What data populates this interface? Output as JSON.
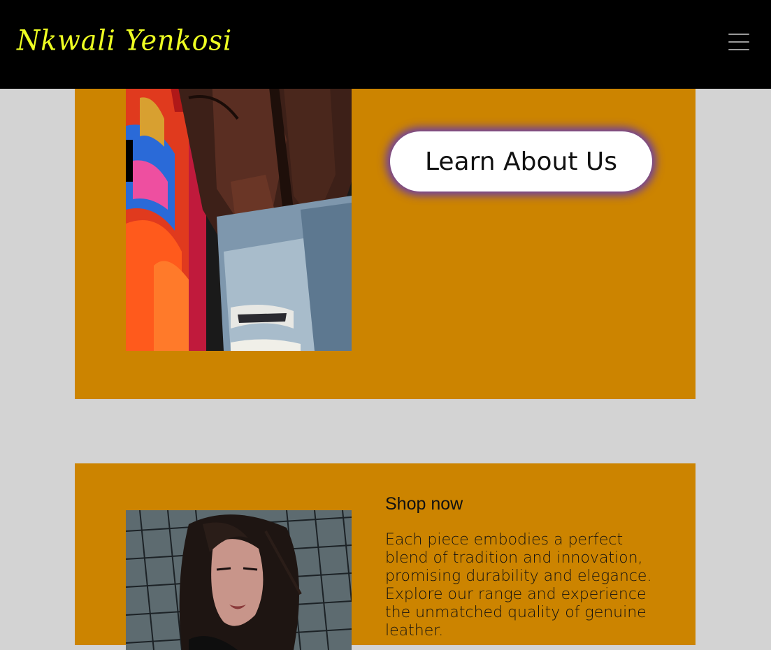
{
  "header": {
    "brand": "Nkwali Yenkosi",
    "brand_color": "#eeff22",
    "menu_icon": "hamburger-icon"
  },
  "about_section": {
    "image_alt": "Person wearing brown leather jacket and ripped jeans in front of colorful mural",
    "button_label": "Learn About Us",
    "card_color": "#cc8400",
    "button_glow_color": "#6d3fa0"
  },
  "shop_section": {
    "image_alt": "Woman with dark hair leaning on metal fence",
    "heading": "Shop now",
    "body": "Each piece embodies a perfect blend of tradition and innovation, promising durability and elegance. Explore our range and experience the unmatched quality of genuine leather."
  }
}
